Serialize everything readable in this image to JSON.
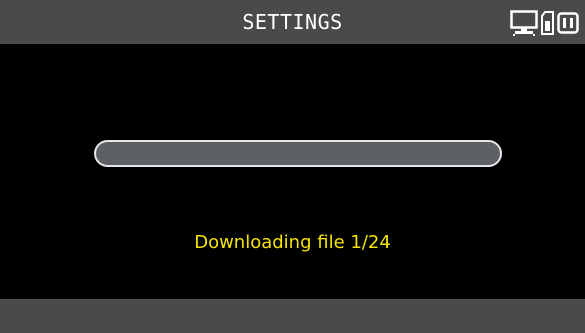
{
  "header": {
    "title": "SETTINGS",
    "status_icons": [
      "computer-icon",
      "sd-card-icon",
      "battery-icon"
    ]
  },
  "progress": {
    "fraction": 0.0
  },
  "message": "Downloading file 1/24",
  "colors": {
    "bar_background": "#4a4a4a",
    "screen_background": "#000000",
    "progress_track": "#5d6166",
    "message_text": "#f5e400",
    "title_text": "#ffffff"
  }
}
